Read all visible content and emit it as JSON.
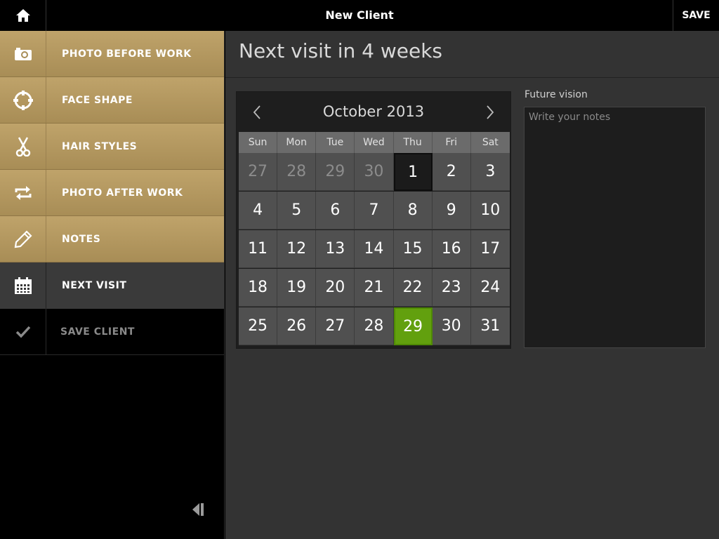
{
  "topbar": {
    "title": "New Client",
    "save_label": "SAVE"
  },
  "sidebar": {
    "items": [
      {
        "label": "PHOTO BEFORE WORK",
        "icon": "camera-icon"
      },
      {
        "label": "FACE SHAPE",
        "icon": "face-shape-icon"
      },
      {
        "label": "HAIR STYLES",
        "icon": "scissors-icon"
      },
      {
        "label": "PHOTO AFTER WORK",
        "icon": "repeat-icon"
      },
      {
        "label": "NOTES",
        "icon": "pencil-icon"
      },
      {
        "label": "NEXT VISIT",
        "icon": "calendar-icon"
      },
      {
        "label": "SAVE CLIENT",
        "icon": "checkmark-icon"
      }
    ]
  },
  "main": {
    "title": "Next visit in 4 weeks"
  },
  "calendar": {
    "month_label": "October 2013",
    "weekdays": [
      "Sun",
      "Mon",
      "Tue",
      "Wed",
      "Thu",
      "Fri",
      "Sat"
    ],
    "weeks": [
      [
        "27",
        "28",
        "29",
        "30",
        "1",
        "2",
        "3"
      ],
      [
        "4",
        "5",
        "6",
        "7",
        "8",
        "9",
        "10"
      ],
      [
        "11",
        "12",
        "13",
        "14",
        "15",
        "16",
        "17"
      ],
      [
        "18",
        "19",
        "20",
        "21",
        "22",
        "23",
        "24"
      ],
      [
        "25",
        "26",
        "27",
        "28",
        "29",
        "30",
        "31"
      ]
    ],
    "selected_day": "29",
    "today_day": "1"
  },
  "notes": {
    "label": "Future vision",
    "placeholder": "Write your notes",
    "value": ""
  },
  "colors": {
    "gold": "#b59a62",
    "selected_green": "#62a00e",
    "panel": "#333333"
  }
}
